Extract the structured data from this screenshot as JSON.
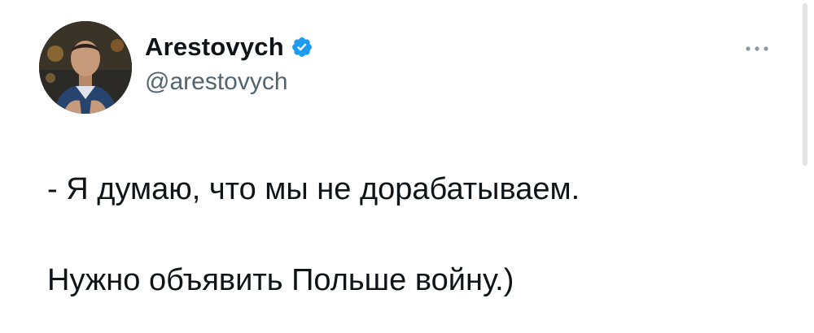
{
  "author": {
    "display_name": "Arestovych",
    "handle": "@arestovych",
    "verified": true,
    "avatar_icon": "user-photo-avatar"
  },
  "tweet": {
    "lines": [
      "- Я думаю, что мы не дорабатываем.",
      "Нужно объявить Польше войну.)"
    ]
  },
  "icons": {
    "verified": "verified-badge-icon",
    "more": "more-options-icon"
  },
  "colors": {
    "text": "#0f1419",
    "secondary_text": "#536471",
    "verified_blue": "#1d9bf0",
    "background": "#ffffff"
  }
}
